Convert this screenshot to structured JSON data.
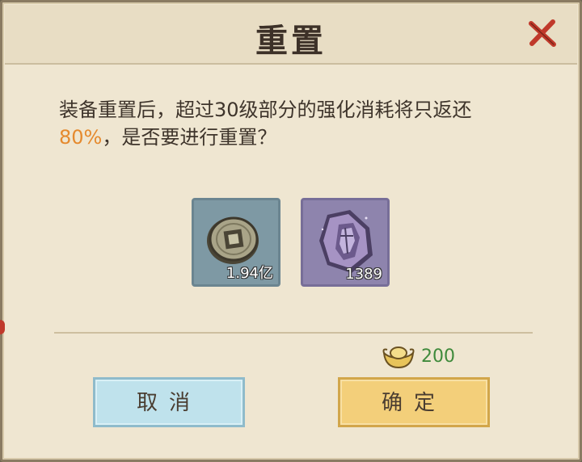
{
  "dialog": {
    "title": "重置",
    "message_prefix": "装备重置后，超过30级部分的强化消耗将只返还",
    "message_highlight": "80%",
    "message_suffix": "，是否要进行重置？"
  },
  "items": [
    {
      "icon": "copper-coin-icon",
      "quantity": "1.94亿"
    },
    {
      "icon": "purple-crystal-icon",
      "quantity": "1389"
    }
  ],
  "cost": {
    "icon": "gold-ingot-icon",
    "amount": "200"
  },
  "buttons": {
    "cancel_label": "取消",
    "confirm_label": "确定"
  },
  "colors": {
    "highlight": "#e58a2e",
    "cost_amount": "#3f8a3b",
    "close_icon": "#c0392b",
    "cancel_button": "#bfe2ec",
    "confirm_button": "#f3cf7a"
  }
}
